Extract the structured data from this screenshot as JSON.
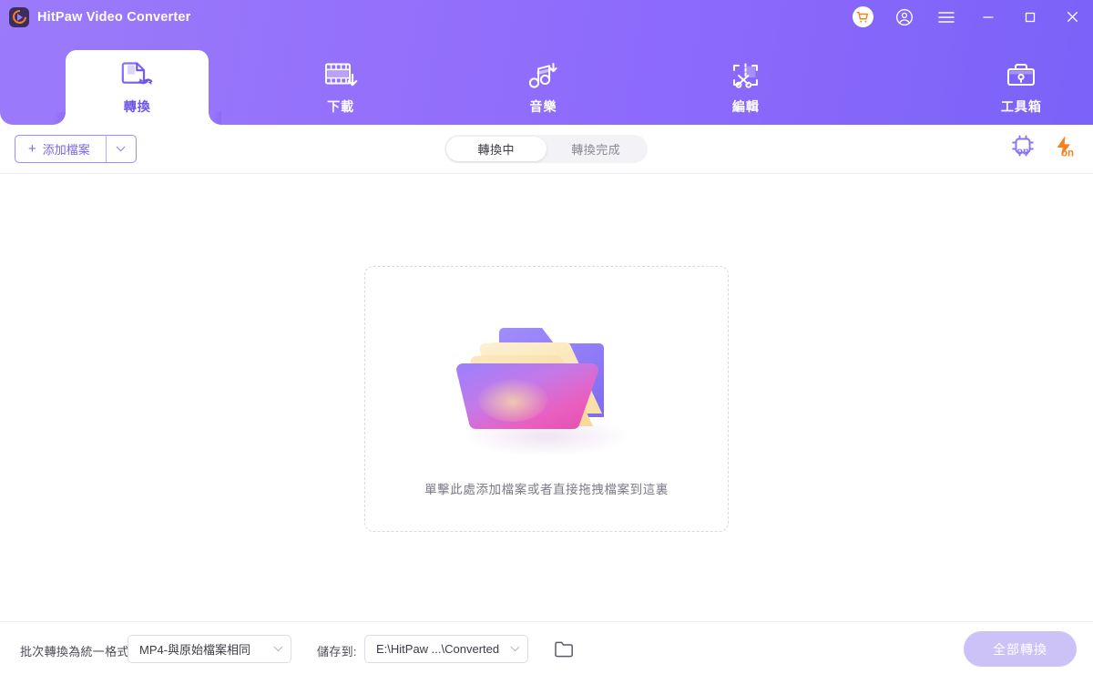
{
  "window": {
    "app_title": "HitPaw Video Converter",
    "logo_icon": "hitpaw-logo-icon",
    "controls": {
      "cart": "cart-icon",
      "account": "user-account-icon",
      "menu": "hamburger-menu-icon",
      "minimize": "minimize-icon",
      "maximize": "maximize-icon",
      "close": "close-icon"
    }
  },
  "nav": {
    "tabs": [
      {
        "label": "轉換",
        "icon": "convert-icon",
        "active": true
      },
      {
        "label": "下載",
        "icon": "download-icon",
        "active": false
      },
      {
        "label": "音樂",
        "icon": "music-icon",
        "active": false
      },
      {
        "label": "編輯",
        "icon": "edit-icon",
        "active": false
      },
      {
        "label": "工具箱",
        "icon": "toolbox-icon",
        "active": false
      }
    ]
  },
  "toolbar": {
    "add_file_label": "添加檔案",
    "add_file_plus": "+",
    "segments": [
      {
        "label": "轉換中",
        "active": true
      },
      {
        "label": "轉換完成",
        "active": false
      }
    ],
    "hardware_accel": {
      "icon": "cpu-chip-icon",
      "state": "on"
    },
    "speed_boost": {
      "icon": "lightning-bolt-icon",
      "state": "on"
    }
  },
  "main": {
    "dropzone_text": "單擊此處添加檔案或者直接拖拽檔案到這裏",
    "illustration": "folder-stack-illustration"
  },
  "bottom": {
    "batch_format_label": "批次轉換為統一格式:",
    "batch_format_value": "MP4-與原始檔案相同",
    "save_to_label": "儲存到:",
    "save_to_value": "E:\\HitPaw ...\\Converted",
    "browse_icon": "open-folder-icon",
    "convert_all_label": "全部轉換"
  },
  "colors": {
    "header_gradient_start": "#9b7bfa",
    "header_gradient_end": "#7b62f8",
    "accent_purple": "#7b64ee",
    "accent_orange": "#f5811f",
    "disabled_button": "#cdc2f8"
  }
}
